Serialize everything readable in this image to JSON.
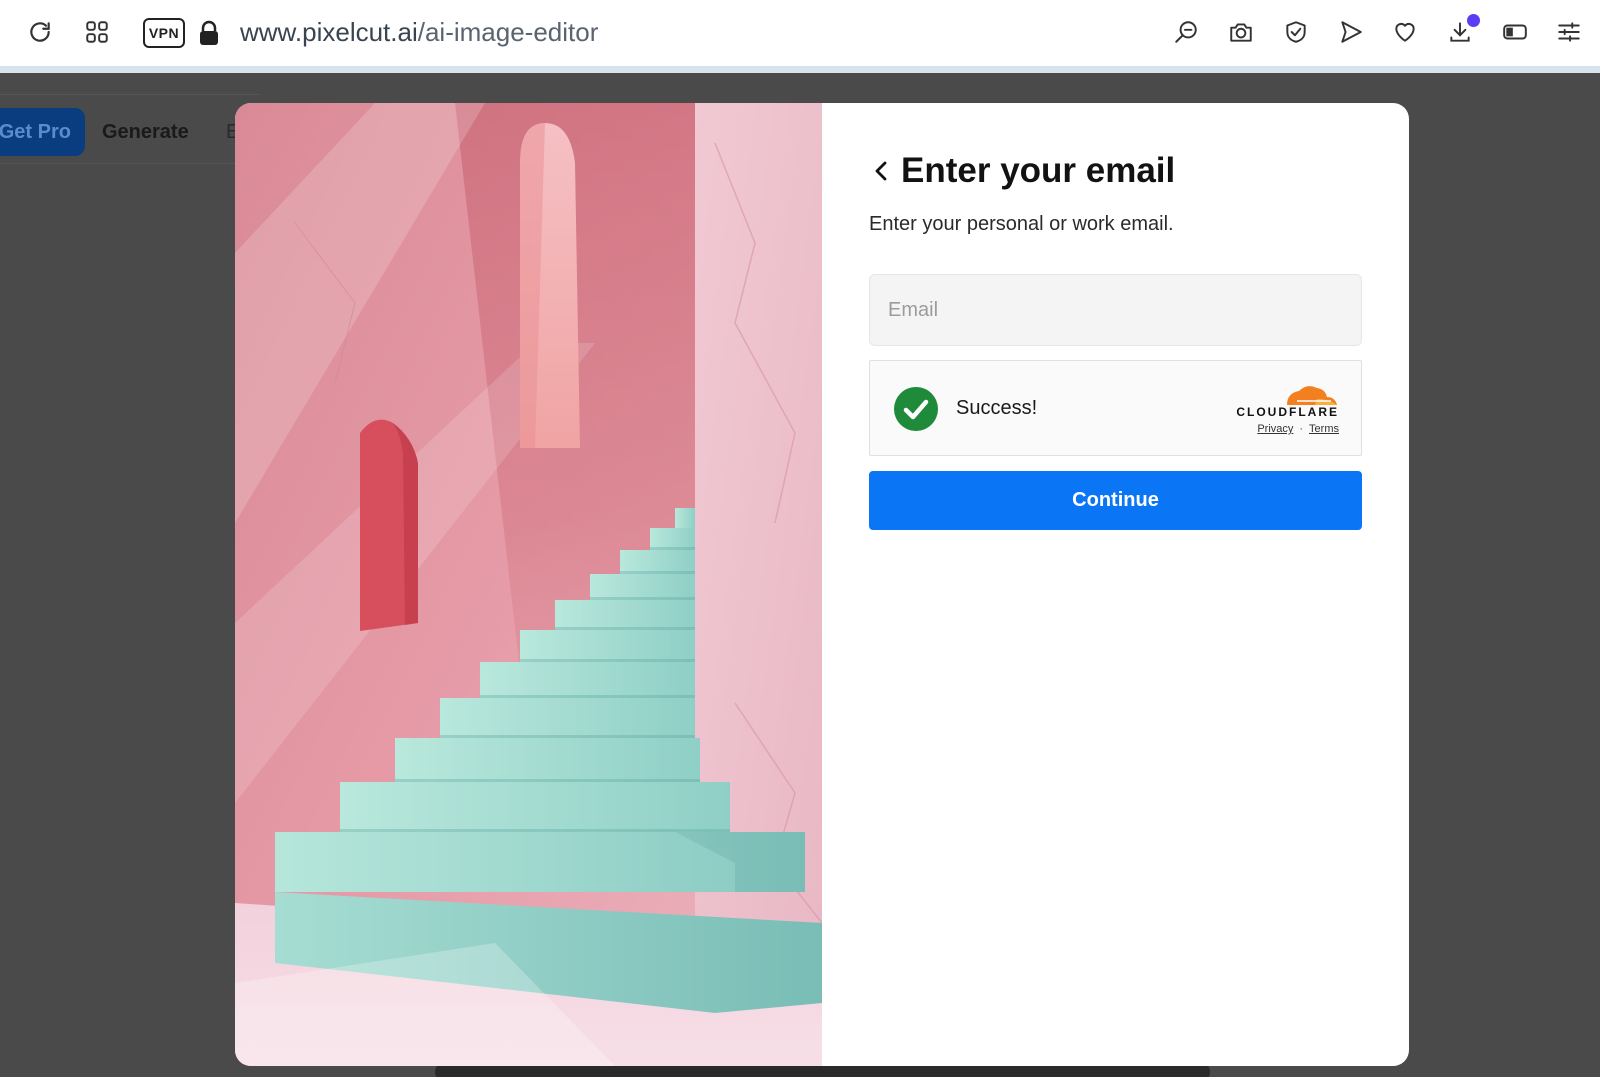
{
  "browser": {
    "url_host": "www.pixelcut.ai",
    "url_path": "/ai-image-editor",
    "vpn_label": "VPN",
    "icons": [
      "reload-icon",
      "tabs-grid-icon",
      "lock-icon",
      "search-icon",
      "camera-icon",
      "shield-check-icon",
      "send-icon",
      "heart-icon",
      "download-icon",
      "battery-icon",
      "settings-sliders-icon"
    ],
    "notification_dot_color": "#5b3df5"
  },
  "background_page": {
    "get_pro_label": "Get Pro",
    "generate_label": "Generate",
    "partial_letter": "E"
  },
  "modal": {
    "title": "Enter your email",
    "subtitle": "Enter your personal or work email.",
    "email_placeholder": "Email",
    "email_value": "",
    "captcha": {
      "status_text": "Success!",
      "provider": "CLOUDFLARE",
      "privacy_link": "Privacy",
      "separator": "·",
      "terms_link": "Terms",
      "check_color": "#1e8a3a",
      "provider_color": "#f38020"
    },
    "continue_label": "Continue",
    "accent_color": "#0a76f5"
  }
}
